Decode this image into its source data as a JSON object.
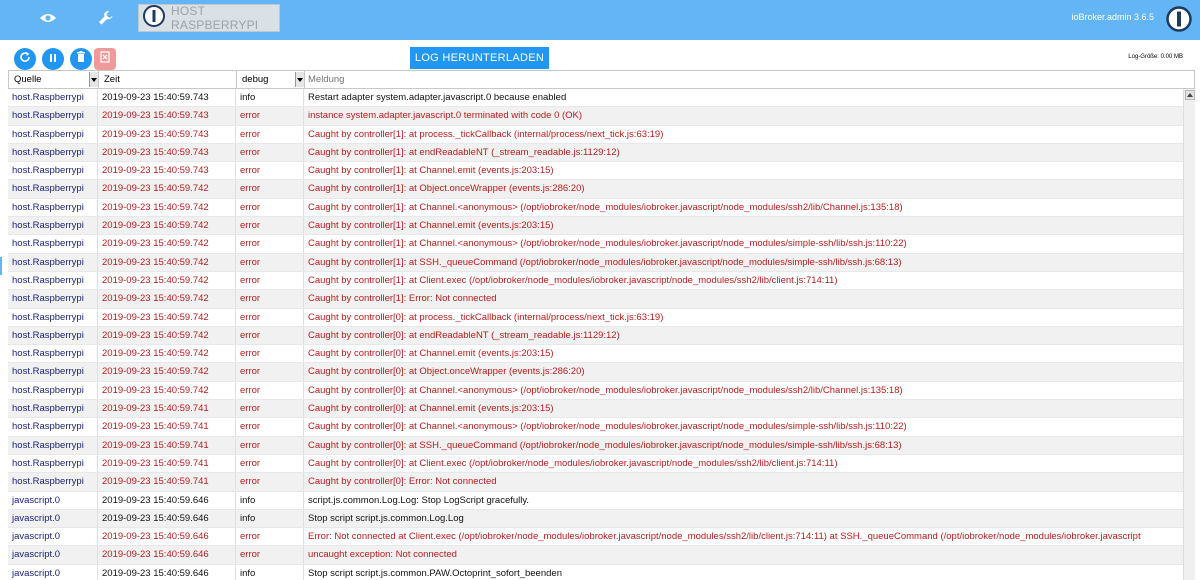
{
  "topbar": {
    "host_tab_label": "HOST RASPBERRYPI",
    "version": "ioBroker.admin 3.6.5",
    "icons": [
      "eye-icon",
      "wrench-icon",
      "iobroker-logo-icon"
    ],
    "color": "#64b5f6"
  },
  "toolbar": {
    "download_label": "LOG HERUNTERLADEN",
    "log_size": "Log-Größe: 0.00 MB",
    "buttons": [
      "refresh-icon",
      "pause-icon",
      "trash-icon",
      "clear-file-icon"
    ]
  },
  "table": {
    "headers": {
      "source": "Quelle",
      "time": "Zeit",
      "level": "debug",
      "message_placeholder": "Meldung"
    },
    "rows": [
      {
        "source": "host.Raspberrypi",
        "time": "2019-09-23 15:40:59.743",
        "level": "info",
        "message": "Restart adapter system.adapter.javascript.0 because enabled"
      },
      {
        "source": "host.Raspberrypi",
        "time": "2019-09-23 15:40:59.743",
        "level": "error",
        "message": "instance system.adapter.javascript.0 terminated with code 0 (OK)"
      },
      {
        "source": "host.Raspberrypi",
        "time": "2019-09-23 15:40:59.743",
        "level": "error",
        "message": "Caught by controller[1]: at process._tickCallback (internal/process/next_tick.js:63:19)"
      },
      {
        "source": "host.Raspberrypi",
        "time": "2019-09-23 15:40:59.743",
        "level": "error",
        "message": "Caught by controller[1]: at endReadableNT (_stream_readable.js:1129:12)"
      },
      {
        "source": "host.Raspberrypi",
        "time": "2019-09-23 15:40:59.743",
        "level": "error",
        "message": "Caught by controller[1]: at Channel.emit (events.js:203:15)"
      },
      {
        "source": "host.Raspberrypi",
        "time": "2019-09-23 15:40:59.742",
        "level": "error",
        "message": "Caught by controller[1]: at Object.onceWrapper (events.js:286:20)"
      },
      {
        "source": "host.Raspberrypi",
        "time": "2019-09-23 15:40:59.742",
        "level": "error",
        "message": "Caught by controller[1]: at Channel.<anonymous> (/opt/iobroker/node_modules/iobroker.javascript/node_modules/ssh2/lib/Channel.js:135:18)"
      },
      {
        "source": "host.Raspberrypi",
        "time": "2019-09-23 15:40:59.742",
        "level": "error",
        "message": "Caught by controller[1]: at Channel.emit (events.js:203:15)"
      },
      {
        "source": "host.Raspberrypi",
        "time": "2019-09-23 15:40:59.742",
        "level": "error",
        "message": "Caught by controller[1]: at Channel.<anonymous> (/opt/iobroker/node_modules/iobroker.javascript/node_modules/simple-ssh/lib/ssh.js:110:22)"
      },
      {
        "source": "host.Raspberrypi",
        "time": "2019-09-23 15:40:59.742",
        "level": "error",
        "message": "Caught by controller[1]: at SSH._queueCommand (/opt/iobroker/node_modules/iobroker.javascript/node_modules/simple-ssh/lib/ssh.js:68:13)"
      },
      {
        "source": "host.Raspberrypi",
        "time": "2019-09-23 15:40:59.742",
        "level": "error",
        "message": "Caught by controller[1]: at Client.exec (/opt/iobroker/node_modules/iobroker.javascript/node_modules/ssh2/lib/client.js:714:11)"
      },
      {
        "source": "host.Raspberrypi",
        "time": "2019-09-23 15:40:59.742",
        "level": "error",
        "message": "Caught by controller[1]: Error: Not connected"
      },
      {
        "source": "host.Raspberrypi",
        "time": "2019-09-23 15:40:59.742",
        "level": "error",
        "message": "Caught by controller[0]: at process._tickCallback (internal/process/next_tick.js:63:19)"
      },
      {
        "source": "host.Raspberrypi",
        "time": "2019-09-23 15:40:59.742",
        "level": "error",
        "message": "Caught by controller[0]: at endReadableNT (_stream_readable.js:1129:12)"
      },
      {
        "source": "host.Raspberrypi",
        "time": "2019-09-23 15:40:59.742",
        "level": "error",
        "message": "Caught by controller[0]: at Channel.emit (events.js:203:15)"
      },
      {
        "source": "host.Raspberrypi",
        "time": "2019-09-23 15:40:59.742",
        "level": "error",
        "message": "Caught by controller[0]: at Object.onceWrapper (events.js:286:20)"
      },
      {
        "source": "host.Raspberrypi",
        "time": "2019-09-23 15:40:59.742",
        "level": "error",
        "message": "Caught by controller[0]: at Channel.<anonymous> (/opt/iobroker/node_modules/iobroker.javascript/node_modules/ssh2/lib/Channel.js:135:18)"
      },
      {
        "source": "host.Raspberrypi",
        "time": "2019-09-23 15:40:59.741",
        "level": "error",
        "message": "Caught by controller[0]: at Channel.emit (events.js:203:15)"
      },
      {
        "source": "host.Raspberrypi",
        "time": "2019-09-23 15:40:59.741",
        "level": "error",
        "message": "Caught by controller[0]: at Channel.<anonymous> (/opt/iobroker/node_modules/iobroker.javascript/node_modules/simple-ssh/lib/ssh.js:110:22)"
      },
      {
        "source": "host.Raspberrypi",
        "time": "2019-09-23 15:40:59.741",
        "level": "error",
        "message": "Caught by controller[0]: at SSH._queueCommand (/opt/iobroker/node_modules/iobroker.javascript/node_modules/simple-ssh/lib/ssh.js:68:13)"
      },
      {
        "source": "host.Raspberrypi",
        "time": "2019-09-23 15:40:59.741",
        "level": "error",
        "message": "Caught by controller[0]: at Client.exec (/opt/iobroker/node_modules/iobroker.javascript/node_modules/ssh2/lib/client.js:714:11)"
      },
      {
        "source": "host.Raspberrypi",
        "time": "2019-09-23 15:40:59.741",
        "level": "error",
        "message": "Caught by controller[0]: Error: Not connected"
      },
      {
        "source": "javascript.0",
        "time": "2019-09-23 15:40:59.646",
        "level": "info",
        "message": "script.js.common.Log.Log: Stop LogScript gracefully."
      },
      {
        "source": "javascript.0",
        "time": "2019-09-23 15:40:59.646",
        "level": "info",
        "message": "Stop script script.js.common.Log.Log"
      },
      {
        "source": "javascript.0",
        "time": "2019-09-23 15:40:59.646",
        "level": "error",
        "message": "Error: Not connected at Client.exec (/opt/iobroker/node_modules/iobroker.javascript/node_modules/ssh2/lib/client.js:714:11) at SSH._queueCommand (/opt/iobroker/node_modules/iobroker.javascript"
      },
      {
        "source": "javascript.0",
        "time": "2019-09-23 15:40:59.646",
        "level": "error",
        "message": "uncaught exception: Not connected"
      },
      {
        "source": "javascript.0",
        "time": "2019-09-23 15:40:59.646",
        "level": "info",
        "message": "Stop script script.js.common.PAW.Octoprint_sofort_beenden"
      }
    ]
  },
  "colors": {
    "accent": "#2196f3",
    "error_text": "#b71c1c",
    "source_text": "#1a237e"
  }
}
